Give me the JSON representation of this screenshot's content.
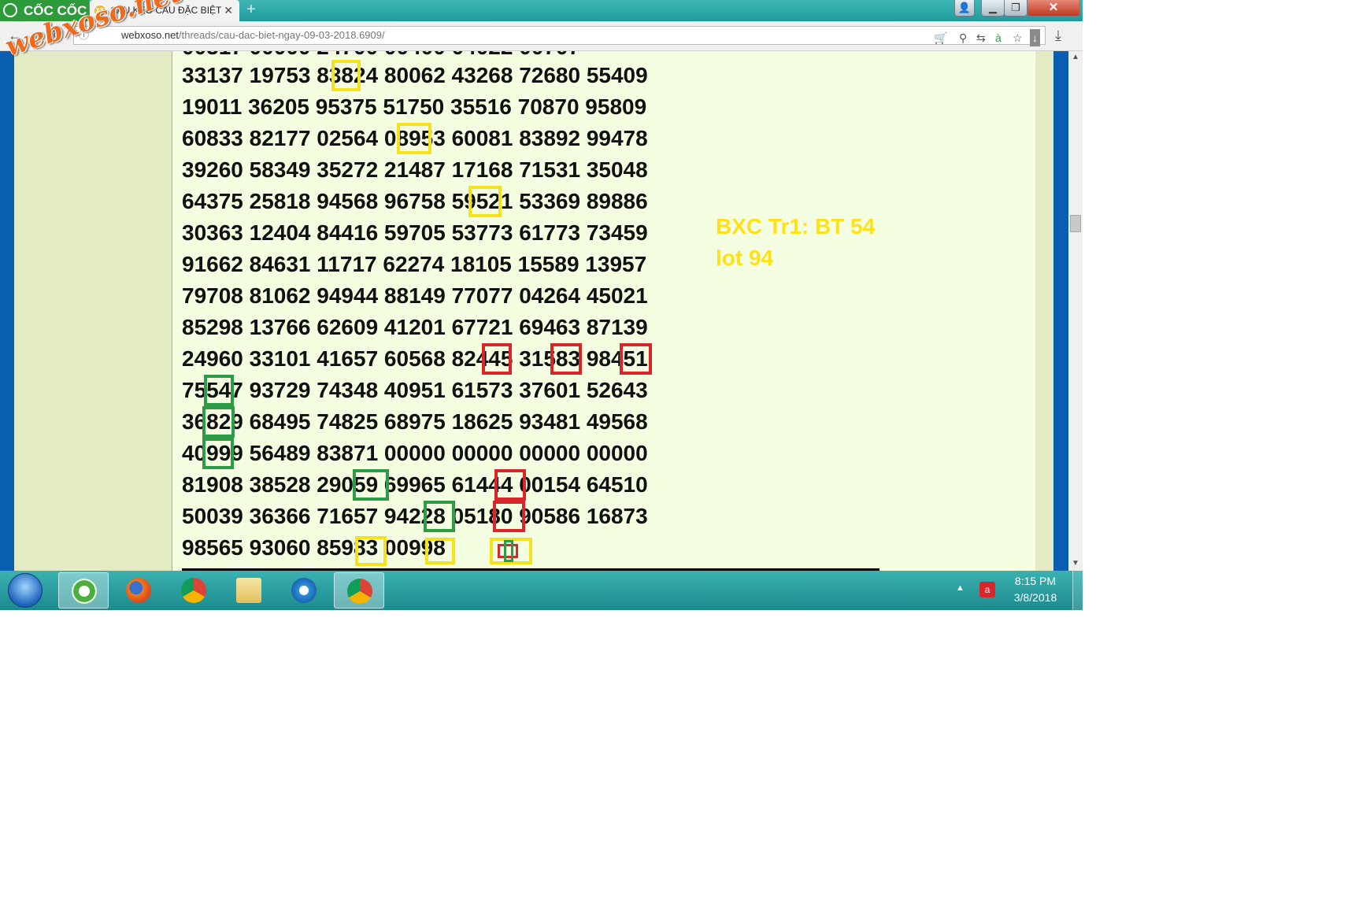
{
  "browser": {
    "brand": "CỐC CỐC",
    "tab_title": "CẦU KÈO CẦU ĐẶC BIỆT",
    "tab_favicon": "XS",
    "url_prefix": "webxoso.net",
    "url_rest": "/threads/cau-dac-biet-ngay-09-03-2018.6909/"
  },
  "watermark": "webxoso.net",
  "grid": {
    "rows": [
      "33137 19753 83824 80062 43268 72680 55409",
      "19011 36205 95375 51750 35516 70870 95809",
      "60833 82177 02564 08953 60081 83892 99478",
      "39260 58349 35272 21487 17168 71531 35048",
      "64375 25818 94568 96758 59521 53369 89886",
      "30363 12404 84416 59705 53773 61773 73459",
      "91662 84631 11717 62274 18105 15589 13957",
      "79708 81062 94944 88149 77077 04264 45021",
      "85298 13766 62609 41201 67721 69463 87139",
      "24960 33101 41657 60568 82445 31583 98451",
      "75547 93729 74348 40951 61573 37601 52643",
      "36829 68495 74825 68975 18625 93481 49568",
      "40999 56489 83871 00000 00000 00000 00000",
      "81908 38528 29059 69965 61444 00154 64510",
      "50039 36366 71657 94228 05180 90586 16873",
      "98565 93060 85983 00998"
    ]
  },
  "note": {
    "line1": "BXC Tr1: BT 54",
    "line2": "lot 94"
  },
  "colors": {
    "yellow_box": "#f4e21d",
    "red_box": "#d8262a",
    "green_box": "#2c9c47",
    "note_text": "#ffe019",
    "post_bg": "#f4ffe1"
  },
  "taskbar": {
    "time": "8:15 PM",
    "date": "3/8/2018"
  }
}
